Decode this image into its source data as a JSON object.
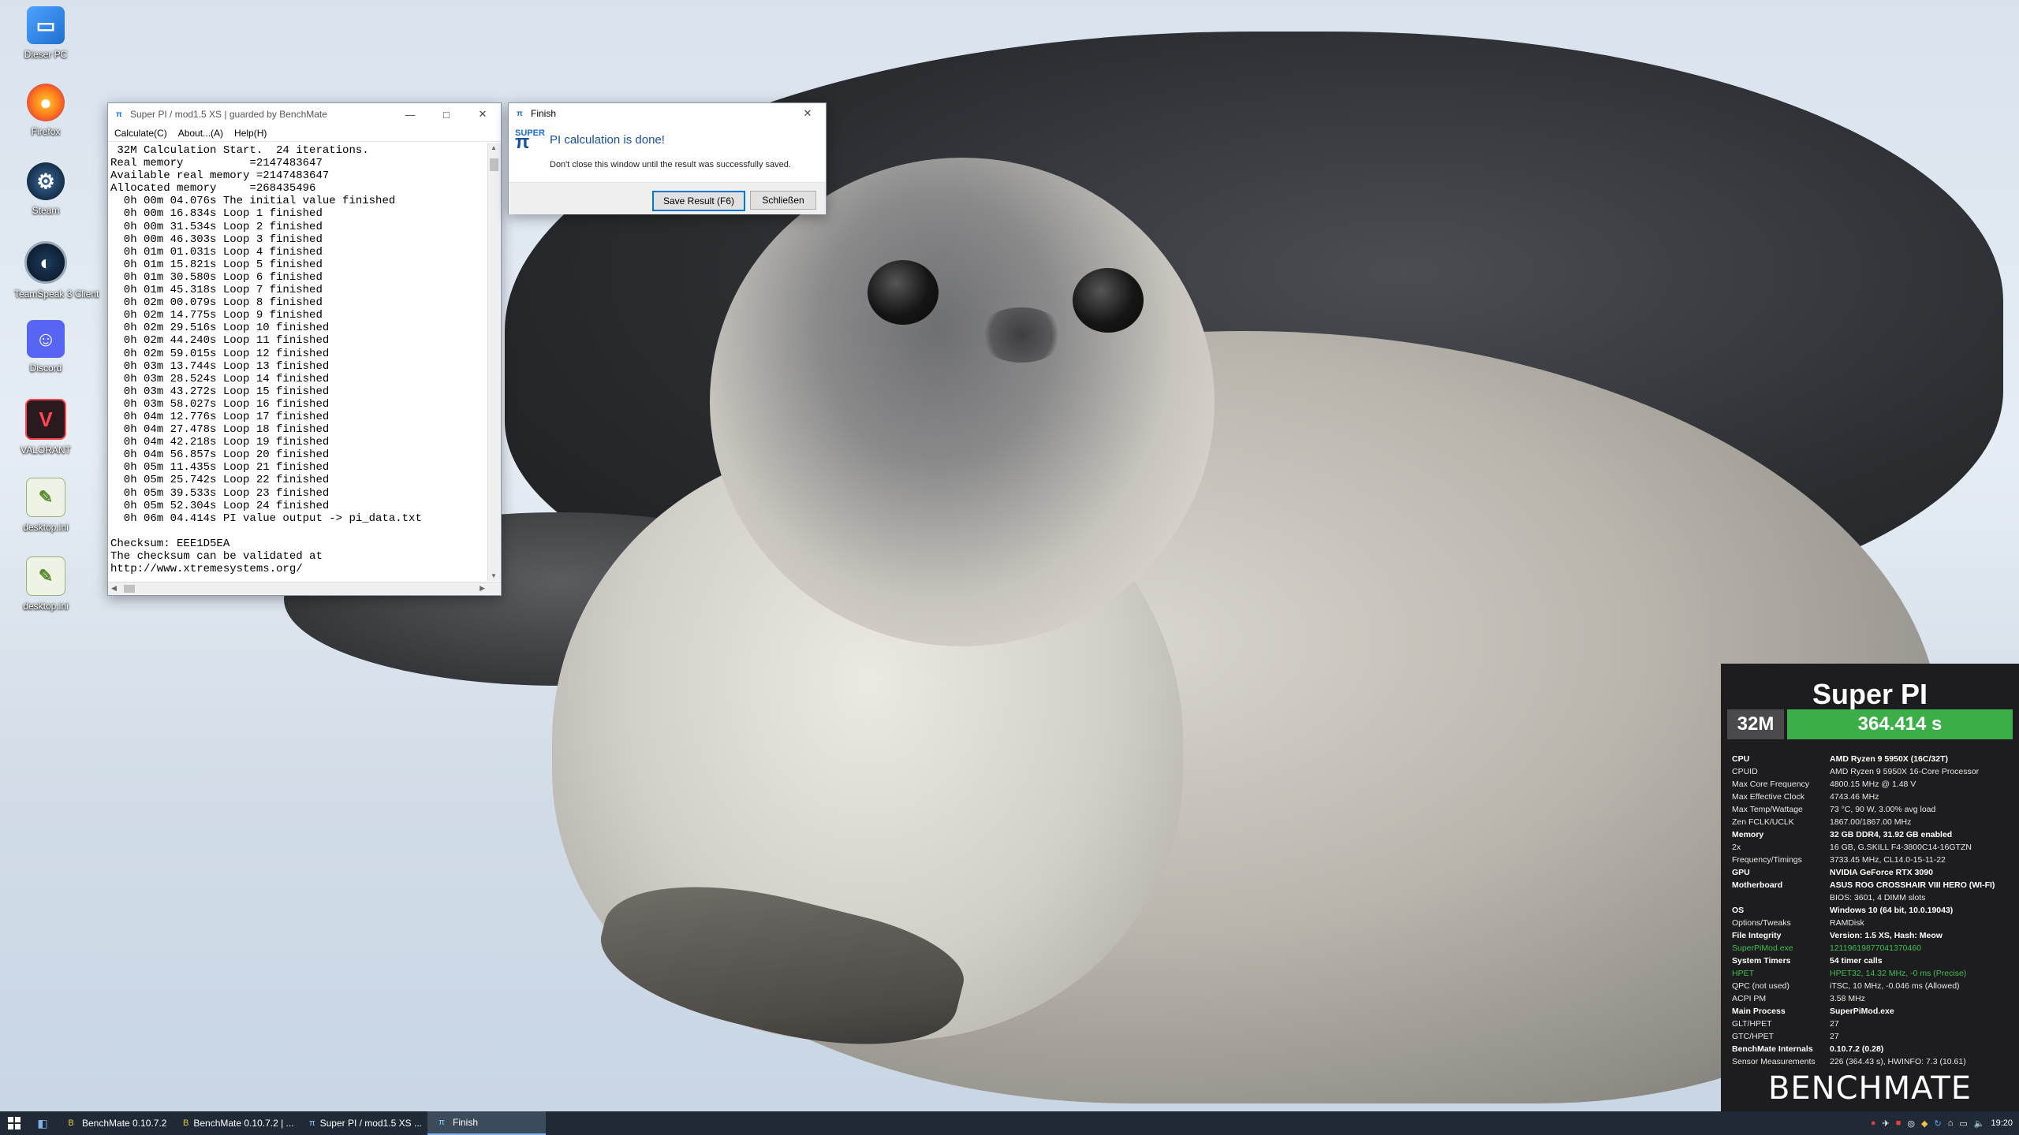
{
  "desktop_icons": [
    {
      "label": "Dieser PC",
      "icon": "computer-icon"
    },
    {
      "label": "Firefox",
      "icon": "firefox-icon"
    },
    {
      "label": "Steam",
      "icon": "steam-icon"
    },
    {
      "label": "TeamSpeak 3 Client",
      "icon": "teamspeak-icon"
    },
    {
      "label": "Discord",
      "icon": "discord-icon"
    },
    {
      "label": "VALORANT",
      "icon": "valorant-icon"
    },
    {
      "label": "desktop.ini",
      "icon": "ini-file-icon"
    },
    {
      "label": "desktop.ini",
      "icon": "ini-file-icon"
    }
  ],
  "superpi": {
    "title": "Super PI / mod1.5 XS | guarded by BenchMate",
    "menu": [
      "Calculate(C)",
      "About...(A)",
      "Help(H)"
    ],
    "console": " 32M Calculation Start.  24 iterations.\nReal memory          =2147483647\nAvailable real memory =2147483647\nAllocated memory     =268435496\n  0h 00m 04.076s The initial value finished\n  0h 00m 16.834s Loop 1 finished\n  0h 00m 31.534s Loop 2 finished\n  0h 00m 46.303s Loop 3 finished\n  0h 01m 01.031s Loop 4 finished\n  0h 01m 15.821s Loop 5 finished\n  0h 01m 30.580s Loop 6 finished\n  0h 01m 45.318s Loop 7 finished\n  0h 02m 00.079s Loop 8 finished\n  0h 02m 14.775s Loop 9 finished\n  0h 02m 29.516s Loop 10 finished\n  0h 02m 44.240s Loop 11 finished\n  0h 02m 59.015s Loop 12 finished\n  0h 03m 13.744s Loop 13 finished\n  0h 03m 28.524s Loop 14 finished\n  0h 03m 43.272s Loop 15 finished\n  0h 03m 58.027s Loop 16 finished\n  0h 04m 12.776s Loop 17 finished\n  0h 04m 27.478s Loop 18 finished\n  0h 04m 42.218s Loop 19 finished\n  0h 04m 56.857s Loop 20 finished\n  0h 05m 11.435s Loop 21 finished\n  0h 05m 25.742s Loop 22 finished\n  0h 05m 39.533s Loop 23 finished\n  0h 05m 52.304s Loop 24 finished\n  0h 06m 04.414s PI value output -> pi_data.txt\n\nChecksum: EEE1D5EA\nThe checksum can be validated at\nhttp://www.xtremesystems.org/"
  },
  "finish": {
    "title": "Finish",
    "message": "PI calculation is done!",
    "note": "Don't close this window until the result was successfully saved.",
    "save_label": "Save Result (F6)",
    "close_label": "Schließen"
  },
  "benchmate": {
    "title": "Super PI",
    "size": "32M",
    "time": "364.414 s",
    "rows": [
      {
        "k": "CPU",
        "v": "AMD Ryzen 9 5950X (16C/32T)",
        "bold": true
      },
      {
        "k": "CPUID",
        "v": "AMD Ryzen 9 5950X 16-Core Processor"
      },
      {
        "k": "Max Core Frequency",
        "v": "4800.15 MHz @ 1.48 V"
      },
      {
        "k": "Max Effective Clock",
        "v": "4743.46 MHz"
      },
      {
        "k": "Max Temp/Wattage",
        "v": "73 °C, 90 W, 3.00% avg load"
      },
      {
        "k": "Zen FCLK/UCLK",
        "v": "1867.00/1867.00 MHz"
      },
      {
        "k": "Memory",
        "v": "32 GB DDR4, 31.92 GB enabled",
        "bold": true
      },
      {
        "k": "2x",
        "v": "16 GB, G.SKILL F4-3800C14-16GTZN"
      },
      {
        "k": "Frequency/Timings",
        "v": "3733.45 MHz, CL14.0-15-11-22"
      },
      {
        "k": "GPU",
        "v": "NVIDIA GeForce RTX 3090",
        "bold": true
      },
      {
        "k": "Motherboard",
        "v": "ASUS ROG CROSSHAIR VIII HERO (WI-FI)",
        "bold": true
      },
      {
        "k": "",
        "v": "BIOS: 3601, 4 DIMM slots"
      },
      {
        "k": "OS",
        "v": "Windows 10 (64 bit, 10.0.19043)",
        "bold": true
      },
      {
        "k": "Options/Tweaks",
        "v": "RAMDisk"
      },
      {
        "k": "File Integrity",
        "v": "Version: 1.5 XS, Hash: Meow",
        "bold": true
      },
      {
        "k": "SuperPiMod.exe",
        "v": "12119619877041370460",
        "green": true
      },
      {
        "k": "System Timers",
        "v": "54 timer calls",
        "bold": true
      },
      {
        "k": "HPET",
        "v": "HPET32, 14.32 MHz, -0 ms (Precise)",
        "green": true
      },
      {
        "k": "QPC (not used)",
        "v": "iTSC, 10 MHz, -0.046 ms (Allowed)"
      },
      {
        "k": "ACPI PM",
        "v": "3.58 MHz"
      },
      {
        "k": "Main Process",
        "v": "SuperPiMod.exe",
        "bold": true
      },
      {
        "k": "GLT/HPET",
        "v": "27"
      },
      {
        "k": "GTC/HPET",
        "v": "27"
      },
      {
        "k": "BenchMate Internals",
        "v": "0.10.7.2 (0.28)",
        "bold": true
      },
      {
        "k": "Sensor Measurements",
        "v": "226 (364.43 s), HWINFO: 7.3 (10.61)"
      }
    ],
    "logo": "BENCHMATE"
  },
  "taskbar": {
    "tasks": [
      {
        "label": "BenchMate 0.10.7.2",
        "icon": "benchmate-icon",
        "active": false
      },
      {
        "label": "BenchMate 0.10.7.2 | ...",
        "icon": "benchmate-icon",
        "active": false
      },
      {
        "label": "Super PI / mod1.5 XS ...",
        "icon": "superpi-icon",
        "active": false
      },
      {
        "label": "Finish",
        "icon": "superpi-icon",
        "active": true
      }
    ],
    "clock": "19:20"
  }
}
